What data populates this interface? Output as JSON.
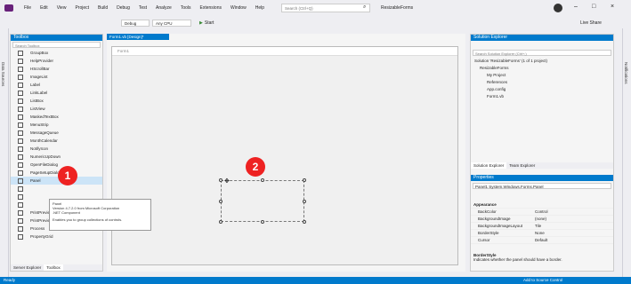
{
  "menu": [
    "File",
    "Edit",
    "View",
    "Project",
    "Build",
    "Debug",
    "Test",
    "Analyze",
    "Tools",
    "Extensions",
    "Window",
    "Help"
  ],
  "search_placeholder": "Search (Ctrl+Q)",
  "solution_name": "ResizableForms",
  "live_share": "Live Share",
  "toolbar": {
    "config": "Debug",
    "platform": "Any CPU",
    "start": "Start"
  },
  "vertical_tab": "Data Sources",
  "vertical_tab_right": "Notifications",
  "toolbox": {
    "title": "Toolbox",
    "search": "Search Toolbox",
    "items": [
      "GroupBox",
      "HelpProvider",
      "HScrollBar",
      "ImageList",
      "Label",
      "LinkLabel",
      "ListBox",
      "ListView",
      "MaskedTextBox",
      "MenuStrip",
      "MessageQueue",
      "MonthCalendar",
      "NotifyIcon",
      "NumericUpDown",
      "OpenFileDialog",
      "PageSetupDialog",
      "Panel",
      "",
      "",
      "",
      "PrintPreviewControl",
      "PrintPreviewDialog",
      "Process",
      "PropertyGrid"
    ],
    "bottom_tabs": [
      "Server Explorer",
      "Toolbox"
    ]
  },
  "tooltip": {
    "line1": "Panel",
    "line2": "Version 4.7.2.0 from Microsoft Corporation",
    "line3": ".NET Component",
    "line4": "Enables you to group collections of controls."
  },
  "designer": {
    "tab": "Form1.vb [Design]*",
    "form_title": "Form1"
  },
  "badges": [
    "1",
    "2"
  ],
  "solution_explorer": {
    "title": "Solution Explorer",
    "search": "Search Solution Explorer (Ctrl+;)",
    "items": [
      "Solution 'ResizableForms' (1 of 1 project)",
      "ResizableForms",
      "My Project",
      "References",
      "App.config",
      "Form1.vb"
    ],
    "tabs": [
      "Solution Explorer",
      "Team Explorer"
    ]
  },
  "properties": {
    "title": "Properties",
    "object": "Panel1  System.Windows.Forms.Panel",
    "category": "Appearance",
    "rows": [
      [
        "BackColor",
        "Control"
      ],
      [
        "BackgroundImage",
        "(none)"
      ],
      [
        "BackgroundImageLayout",
        "Tile"
      ],
      [
        "BorderStyle",
        "None"
      ],
      [
        "Cursor",
        "Default"
      ]
    ],
    "desc_title": "BorderStyle",
    "desc": "Indicates whether the panel should have a border."
  },
  "status": {
    "left": "Ready",
    "right": "Add to Source Control"
  }
}
